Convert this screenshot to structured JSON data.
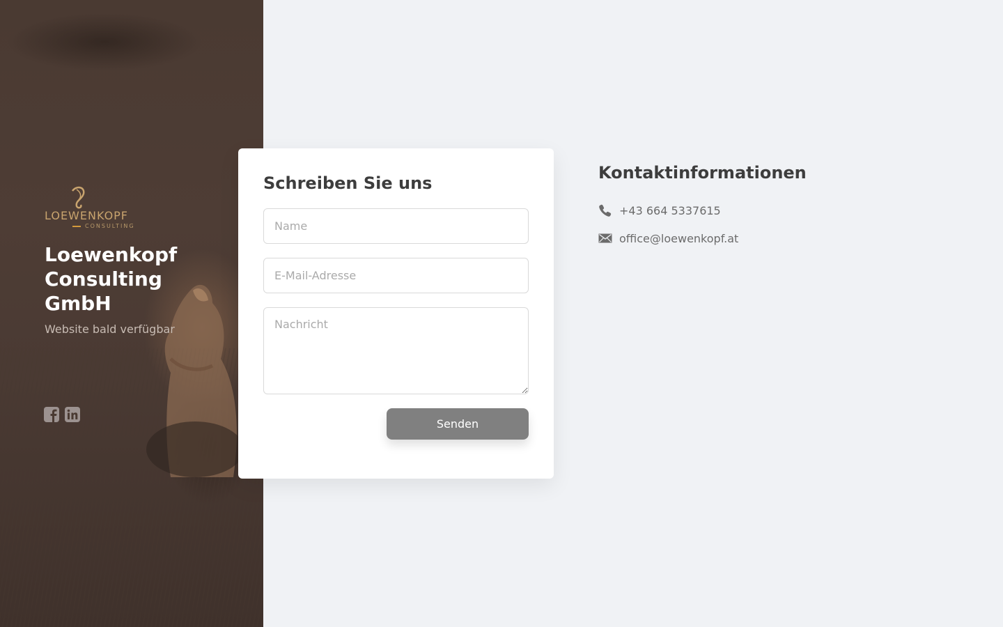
{
  "brand": {
    "logo_word": "LOEWENKOPF",
    "logo_sub": "CONSULTING",
    "company_name": "Loewenkopf Consulting GmbH",
    "tagline": "Website bald verfügbar",
    "accent_color": "#c9a46e"
  },
  "social": [
    {
      "icon": "facebook-icon"
    },
    {
      "icon": "linkedin-icon"
    }
  ],
  "form": {
    "title": "Schreiben Sie uns",
    "name_placeholder": "Name",
    "email_placeholder": "E-Mail-Adresse",
    "message_placeholder": "Nachricht",
    "submit_label": "Senden",
    "button_color": "#808080"
  },
  "contact": {
    "title": "Kontaktinformationen",
    "phone": "+43 664 5337615",
    "email": "office@loewenkopf.at",
    "phone_icon": "phone-icon",
    "email_icon": "envelope-icon"
  }
}
